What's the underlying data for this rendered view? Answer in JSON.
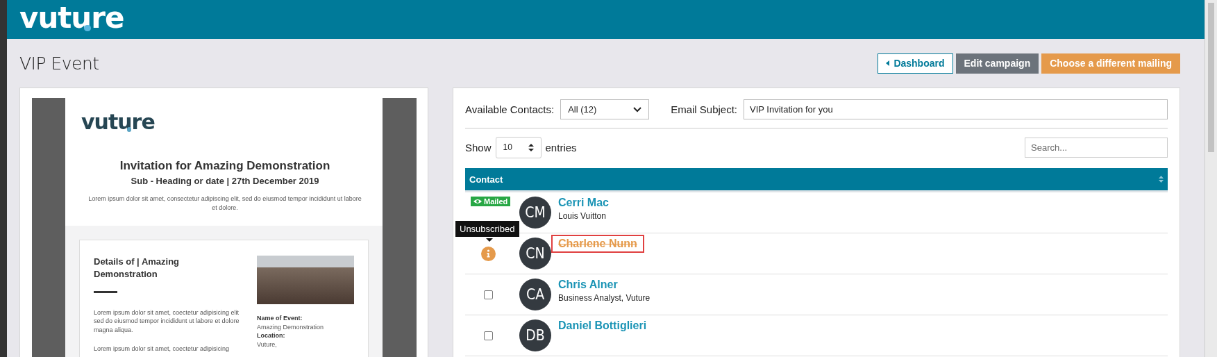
{
  "header": {
    "logo": "vuture"
  },
  "page": {
    "title": "VIP Event"
  },
  "actions": [
    {
      "label": "Dashboard",
      "kind": "outline"
    },
    {
      "label": "Edit campaign",
      "kind": "gray"
    },
    {
      "label": "Choose a different mailing",
      "kind": "orange"
    }
  ],
  "email_preview": {
    "logo": "vuture",
    "heading": "Invitation for Amazing Demonstration",
    "subheading": "Sub - Heading or date | 27th December 2019",
    "intro": "Lorem ipsum dolor sit amet, consectetur adipiscing elit, sed do eiusmod tempor incididunt ut labore et dolore.",
    "details": {
      "title": "Details of | Amazing Demonstration",
      "paragraphs": [
        "Lorem ipsum dolor sit amet, coectetur adipisicing elit sed do eiusmod tempor incididunt ut labore et dolore magna aliqua.",
        "Lorem ipsum dolor sit amet, coectetur adipisicing"
      ],
      "event_info": [
        {
          "label": "Name of Event:",
          "value": "Amazing Demonstration"
        },
        {
          "label": "Location:",
          "value": "Vuture,"
        }
      ]
    }
  },
  "contacts": {
    "filter_label": "Available Contacts:",
    "filter_value": "All (12)",
    "subject_label": "Email Subject:",
    "subject_value": "VIP Invitation for you",
    "show_label": "Show",
    "page_size": "10",
    "entries_label": "entries",
    "search_placeholder": "Search...",
    "column": "Contact",
    "rows": [
      {
        "kind": "mailed",
        "badge": "Mailed",
        "initials": "CM",
        "name": "Cerri Mac",
        "subtitle": "Louis Vuitton",
        "highlighted": false
      },
      {
        "kind": "unsubscribed",
        "tooltip": "Unsubscribed",
        "initials": "CN",
        "name": "Charlene Nunn",
        "highlighted": true
      },
      {
        "kind": "checkbox",
        "checked": false,
        "initials": "CA",
        "name": "Chris Alner",
        "subtitle": "Business Analyst, Vuture",
        "highlighted": false
      },
      {
        "kind": "checkbox",
        "checked": false,
        "initials": "DB",
        "name": "Daniel Bottiglieri",
        "highlighted": false
      }
    ]
  }
}
